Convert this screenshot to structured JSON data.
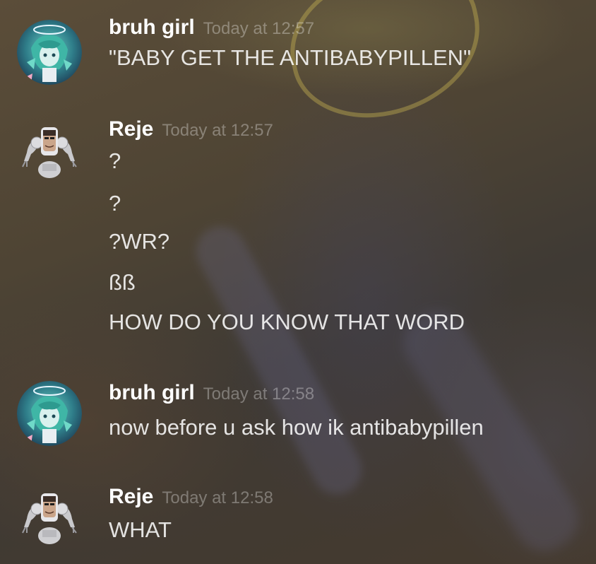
{
  "messages": [
    {
      "author": "bruh girl",
      "timestamp": "Today at 12:57",
      "avatar": "anime-girl-avatar",
      "lines": [
        "\"BABY GET THE ANTIBABYPILLEN\""
      ]
    },
    {
      "author": "Reje",
      "timestamp": "Today at 12:57",
      "avatar": "robot-avatar",
      "lines": [
        "?",
        "?",
        "?WR?",
        "ßß",
        "HOW DO YOU KNOW THAT WORD"
      ]
    },
    {
      "author": "bruh girl",
      "timestamp": "Today at 12:58",
      "avatar": "anime-girl-avatar",
      "lines": [
        "now before u ask how ik antibabypillen"
      ]
    },
    {
      "author": "Reje",
      "timestamp": "Today at 12:58",
      "avatar": "robot-avatar",
      "lines": [
        "WHAT"
      ]
    }
  ]
}
